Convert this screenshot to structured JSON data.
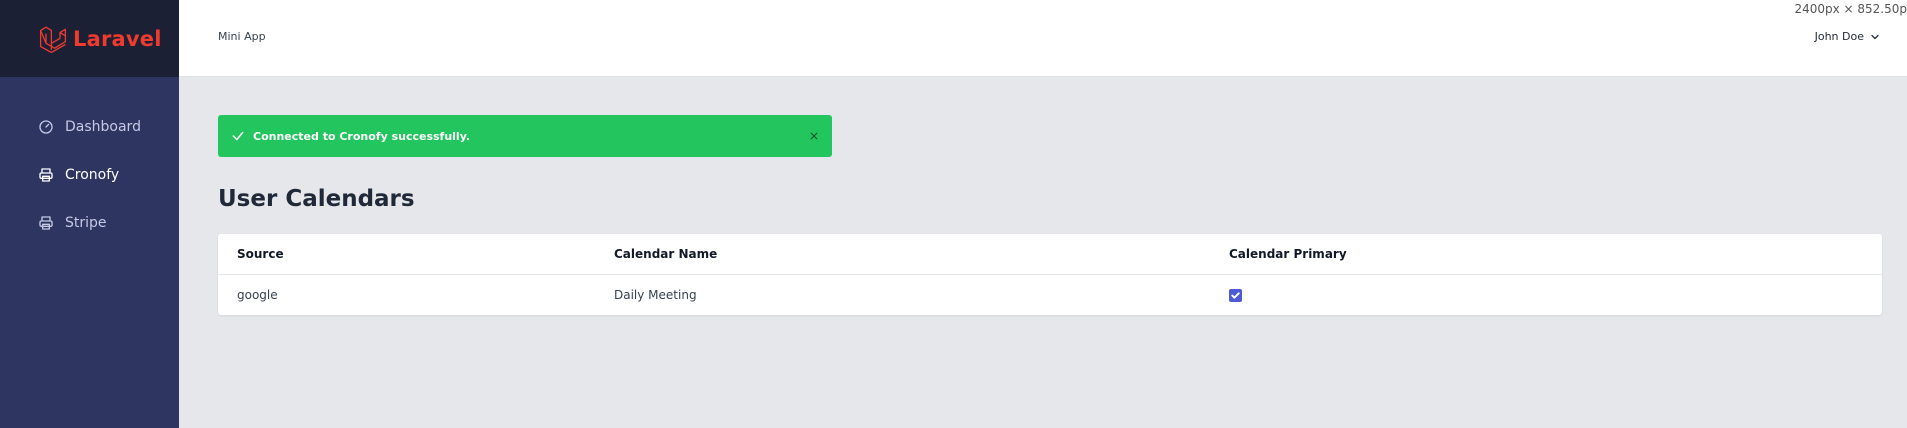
{
  "brand": {
    "name": "Laravel",
    "color": "#ef3b2d",
    "icon": "laravel-logo"
  },
  "sidebar": {
    "items": [
      {
        "label": "Dashboard",
        "icon": "speedometer-icon",
        "active": false
      },
      {
        "label": "Cronofy",
        "icon": "printer-icon",
        "active": true
      },
      {
        "label": "Stripe",
        "icon": "printer-icon",
        "active": false
      }
    ]
  },
  "header": {
    "app_title": "Mini App",
    "user_name": "John Doe",
    "dims_overlay": "2400px × 852.50p"
  },
  "alert": {
    "message": "Connected to Cronofy successfully.",
    "color": "#22c55e"
  },
  "page": {
    "title": "User Calendars"
  },
  "table": {
    "columns": [
      "Source",
      "Calendar Name",
      "Calendar Primary"
    ],
    "rows": [
      {
        "source": "google",
        "calendar_name": "Daily Meeting",
        "primary": true
      }
    ]
  }
}
